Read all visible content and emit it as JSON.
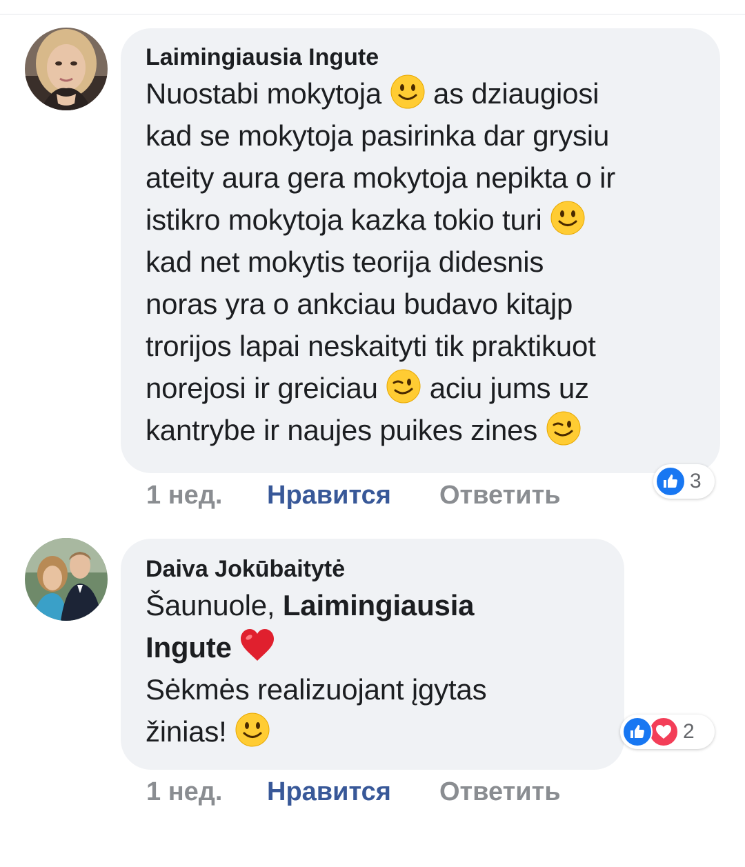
{
  "comments": [
    {
      "author": "Laimingiausia Ingute",
      "lines": [
        {
          "pre": "Nuostabi mokytoja  ",
          "emoji": "slightly-smiling-face",
          "post": " as dziaugiosi"
        },
        {
          "pre": "kad se mokytoja pasirinka dar grysiu"
        },
        {
          "pre": "ateity aura gera mokytoja nepikta  o ir"
        },
        {
          "pre": "istikro mokytoja  kazka tokio turi ",
          "emoji": "slightly-smiling-face"
        },
        {
          "pre": "kad net  mokytis teorija didesnis"
        },
        {
          "pre": "noras yra   o ankciau budavo kitajp"
        },
        {
          "pre": "trorijos lapai neskaityti tik praktikuot"
        },
        {
          "pre": "norejosi  ir greiciau ",
          "emoji": "winking-face",
          "post": "   aciu jums uz"
        },
        {
          "pre": "kantrybe ir naujes puikes zines ",
          "emoji": "winking-face"
        }
      ],
      "time": "1 нед.",
      "like_label": "Нравится",
      "reply_label": "Ответить",
      "reactions": {
        "icons": [
          "like-icon"
        ],
        "count": "3"
      }
    },
    {
      "author": "Daiva Jokūbaitytė",
      "line1_pre": "Šaunuole, ",
      "mention_part1": "Laimingiausia",
      "mention_part2": "Ingute",
      "line2_emoji": "red-heart",
      "line3": "Sėkmės realizuojant įgytas",
      "line4_pre": "žinias! ",
      "line4_emoji": "slightly-smiling-face",
      "time": "1 нед.",
      "like_label": "Нравится",
      "reply_label": "Ответить",
      "reactions": {
        "icons": [
          "like-icon",
          "love-icon"
        ],
        "count": "2"
      }
    }
  ],
  "colors": {
    "bubble": "#f0f2f5",
    "action_gray": "#8a8d91",
    "like_blue": "#385898",
    "reaction_like": "#1877f2",
    "reaction_love": "#f33e58"
  }
}
